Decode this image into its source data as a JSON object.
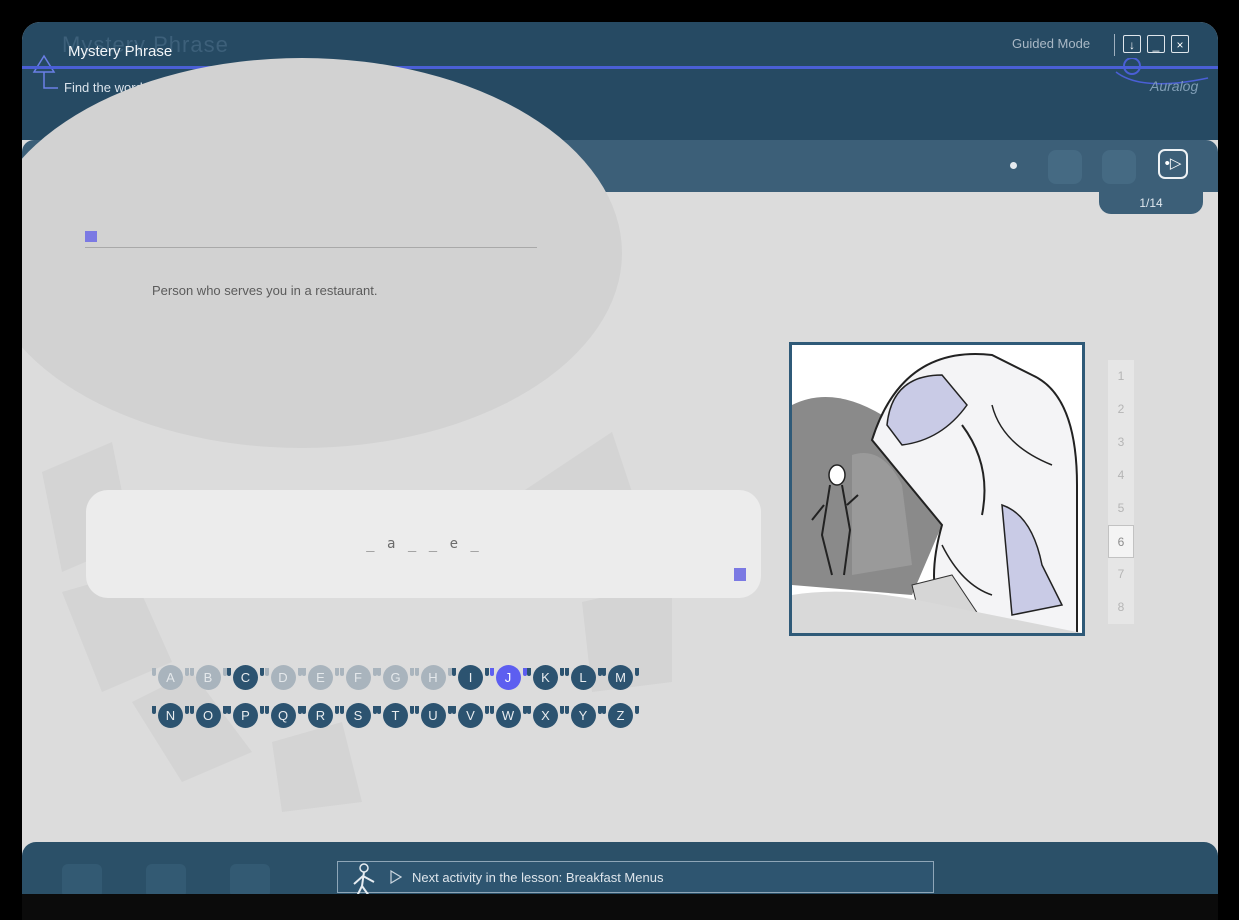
{
  "header": {
    "title": "Mystery Phrase",
    "title_ghost": "Mystery Phrase",
    "instruction": "Find the word or expression that corresponds to the definition.",
    "mode": "Guided Mode",
    "brand": "Auralog",
    "window_buttons": [
      "↓",
      "_",
      "×"
    ]
  },
  "toolbar": {
    "next_label": "•▷",
    "counter": "1/14"
  },
  "exercise": {
    "definition": "Person who serves you in a restaurant.",
    "pattern": "_ a _ _ e _"
  },
  "letters": {
    "row1": [
      {
        "l": "A",
        "state": "used"
      },
      {
        "l": "B",
        "state": "used"
      },
      {
        "l": "C",
        "state": "available"
      },
      {
        "l": "D",
        "state": "used"
      },
      {
        "l": "E",
        "state": "used"
      },
      {
        "l": "F",
        "state": "used"
      },
      {
        "l": "G",
        "state": "used"
      },
      {
        "l": "H",
        "state": "used"
      },
      {
        "l": "I",
        "state": "available"
      },
      {
        "l": "J",
        "state": "selected"
      },
      {
        "l": "K",
        "state": "available"
      },
      {
        "l": "L",
        "state": "available"
      },
      {
        "l": "M",
        "state": "available"
      }
    ],
    "row2": [
      {
        "l": "N",
        "state": "available"
      },
      {
        "l": "O",
        "state": "available"
      },
      {
        "l": "P",
        "state": "available"
      },
      {
        "l": "Q",
        "state": "available"
      },
      {
        "l": "R",
        "state": "available"
      },
      {
        "l": "S",
        "state": "available"
      },
      {
        "l": "T",
        "state": "available"
      },
      {
        "l": "U",
        "state": "available"
      },
      {
        "l": "V",
        "state": "available"
      },
      {
        "l": "W",
        "state": "available"
      },
      {
        "l": "X",
        "state": "available"
      },
      {
        "l": "Y",
        "state": "available"
      },
      {
        "l": "Z",
        "state": "available"
      }
    ]
  },
  "pages": {
    "items": [
      "1",
      "2",
      "3",
      "4",
      "5",
      "6",
      "7",
      "8"
    ],
    "active": "6"
  },
  "footer": {
    "next_activity": "Next activity in the lesson: Breakfast Menus"
  },
  "colors": {
    "header": "#264a63",
    "accent_line": "#4a5fd6",
    "letter_available": "#2c5370",
    "letter_used": "#a9b4bd",
    "letter_selected": "#5d5ef0",
    "marker": "#7b79e3"
  }
}
